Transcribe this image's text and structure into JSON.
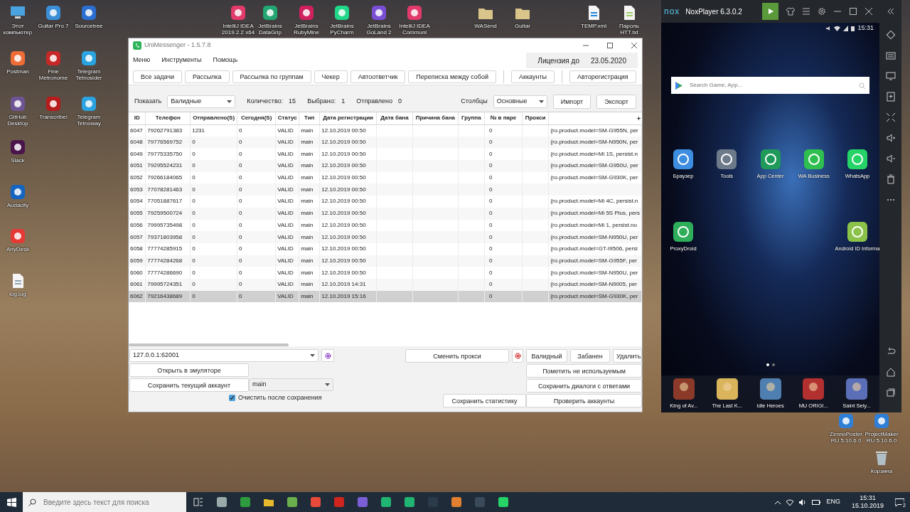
{
  "desktop": {
    "icons": [
      {
        "label": "Этот компьютер"
      },
      {
        "label": "Guitar Pro 7"
      },
      {
        "label": "Sourcetree"
      },
      {
        "label": "IntelliJ IDEA 2019.2.2 x64"
      },
      {
        "label": "JetBrains DataGrip"
      },
      {
        "label": "JetBrains RubyMine"
      },
      {
        "label": "JetBrains PyCharm"
      },
      {
        "label": "JetBrains GoLand 2"
      },
      {
        "label": "IntelliJ IDEA Communi"
      },
      {
        "label": "WASend"
      },
      {
        "label": "Guitar"
      },
      {
        "label": "TEMP.xml"
      },
      {
        "label": "Пароль HTT.txt"
      },
      {
        "label": "Postman"
      },
      {
        "label": "Fine Metronome"
      },
      {
        "label": "Telegram Tetnosider"
      },
      {
        "label": "GitHub Desktop"
      },
      {
        "label": "Transcribe!"
      },
      {
        "label": "Telegram Tetnoway"
      },
      {
        "label": "Slack"
      },
      {
        "label": "Audacity"
      },
      {
        "label": "AnyDesk"
      },
      {
        "label": "log.log"
      },
      {
        "label": "ZennoPoster RU 5.10.6.0"
      },
      {
        "label": "ProjectMaker RU 5.10.6.0"
      },
      {
        "label": "Корзина"
      }
    ]
  },
  "unimessenger": {
    "title": "UniMessenger - 1.5.7.8",
    "menu": [
      "Меню",
      "Инструменты",
      "Помощь"
    ],
    "license_label": "Лицензия до",
    "license_date": "23.05.2020",
    "toolbar_groups": [
      [
        "Все задачи",
        "Рассылка",
        "Рассылка по группам",
        "Чекер",
        "Автоответчик",
        "Переписка между собой"
      ],
      [
        "Аккаунты"
      ],
      [
        "Авторегистрация"
      ]
    ],
    "filter": {
      "show_label": "Показать",
      "show_value": "Валидные",
      "stats": [
        {
          "label": "Количество:",
          "value": "15"
        },
        {
          "label": "Выбрано:",
          "value": "1"
        },
        {
          "label": "Отправлено",
          "value": "0"
        }
      ],
      "columns_label": "Столбцы",
      "columns_value": "Основные",
      "import": "Импорт",
      "export": "Экспорт"
    },
    "table": {
      "columns": [
        "ID",
        "Телефон",
        "Отправлено(S)",
        "Сегодня(S)",
        "Статус",
        "Тип",
        "Дата регистрации",
        "Дата бана",
        "Причина бана",
        "Группа",
        "№ в паре",
        "Прокси"
      ],
      "rows": [
        {
          "id": "6047",
          "phone": "79262791383",
          "sent": "1231",
          "today": "0",
          "status": "VALID",
          "type": "main",
          "registered": "12.10.2019 00:50",
          "pair": "0",
          "column_13": "{ro.product.model=SM-G955N, per",
          "selected": false
        },
        {
          "id": "6048",
          "phone": "79776569752",
          "sent": "0",
          "today": "0",
          "status": "VALID",
          "type": "main",
          "registered": "12.10.2019 00:50",
          "pair": "0",
          "column_13": "{ro.product.model=SM-N950N, per",
          "selected": false
        },
        {
          "id": "6049",
          "phone": "79775335750",
          "sent": "0",
          "today": "0",
          "status": "VALID",
          "type": "main",
          "registered": "12.10.2019 00:50",
          "pair": "0",
          "column_13": "{ro.product.model=Mi 1S, persist.n",
          "selected": false
        },
        {
          "id": "6051",
          "phone": "79295524231",
          "sent": "0",
          "today": "0",
          "status": "VALID",
          "type": "main",
          "registered": "12.10.2019 00:50",
          "pair": "0",
          "column_13": "{ro.product.model=SM-G950U, per",
          "selected": false
        },
        {
          "id": "6052",
          "phone": "79266184065",
          "sent": "0",
          "today": "0",
          "status": "VALID",
          "type": "main",
          "registered": "12.10.2019 00:50",
          "pair": "0",
          "column_13": "{ro.product.model=SM-G930K, per",
          "selected": false
        },
        {
          "id": "6053",
          "phone": "77078281463",
          "sent": "0",
          "today": "0",
          "status": "VALID",
          "type": "main",
          "registered": "12.10.2019 00:50",
          "pair": "0",
          "selected": false
        },
        {
          "id": "6054",
          "phone": "77051887617",
          "sent": "0",
          "today": "0",
          "status": "VALID",
          "type": "main",
          "registered": "12.10.2019 00:50",
          "pair": "0",
          "column_13": "{ro.product.model=Mi 4C, persist.n",
          "selected": false
        },
        {
          "id": "6055",
          "phone": "79259500724",
          "sent": "0",
          "today": "0",
          "status": "VALID",
          "type": "main",
          "registered": "12.10.2019 00:50",
          "pair": "0",
          "column_13": "{ro.product.model=Mi 5S Plus, pers",
          "selected": false
        },
        {
          "id": "6056",
          "phone": "79995735498",
          "sent": "0",
          "today": "0",
          "status": "VALID",
          "type": "main",
          "registered": "12.10.2019 00:50",
          "pair": "0",
          "column_13": "{ro.product.model=Mi 1, persist.no",
          "selected": false
        },
        {
          "id": "6057",
          "phone": "79371803958",
          "sent": "0",
          "today": "0",
          "status": "VALID",
          "type": "main",
          "registered": "12.10.2019 00:50",
          "pair": "0",
          "column_13": "{ro.product.model=SM-N950U, per",
          "selected": false
        },
        {
          "id": "6058",
          "phone": "77774285915",
          "sent": "0",
          "today": "0",
          "status": "VALID",
          "type": "main",
          "registered": "12.10.2019 00:50",
          "pair": "0",
          "column_13": "{ro.product.model=GT-I9506, persi",
          "selected": false
        },
        {
          "id": "6059",
          "phone": "77774284268",
          "sent": "0",
          "today": "0",
          "status": "VALID",
          "type": "main",
          "registered": "12.10.2019 00:50",
          "pair": "0",
          "column_13": "{ro.product.model=SM-G955F, per",
          "selected": false
        },
        {
          "id": "6060",
          "phone": "77774286690",
          "sent": "0",
          "today": "0",
          "status": "VALID",
          "type": "main",
          "registered": "12.10.2019 00:50",
          "pair": "0",
          "column_13": "{ro.product.model=SM-N950U, per",
          "selected": false
        },
        {
          "id": "6061",
          "phone": "79995724351",
          "sent": "0",
          "today": "0",
          "status": "VALID",
          "type": "main",
          "registered": "12.10.2019 14:31",
          "pair": "0",
          "column_13": "{ro.product.model=SM-N9005, per",
          "selected": false
        },
        {
          "id": "6062",
          "phone": "79216438689",
          "sent": "0",
          "today": "0",
          "status": "VALID",
          "type": "main",
          "registered": "12.10.2019 15:16",
          "pair": "0",
          "column_13": "{ro.product.model=SM-G930K, per",
          "selected": true
        }
      ]
    },
    "bottom_panel": {
      "proxy": "127.0.0.1:62001",
      "change_proxy": "Сменить прокси",
      "mark_buttons": [
        "Валидный",
        "Забанен",
        "Удалить"
      ],
      "open_in_emulator": "Открыть в эмуляторе",
      "mark_unused": "Пометить не используемым",
      "save_account": "Сохранить текущий аккаунт",
      "account_type": "main",
      "save_dialogs": "Сохранить диалоги с ответами",
      "clear_after_save": {
        "label": "Очистить после сохранения",
        "checked": true
      },
      "save_stats": "Сохранить статистику",
      "check_accounts": "Проверить аккаунты"
    }
  },
  "nox": {
    "logo": "nox",
    "title": "NoxPlayer 6.3.0.2",
    "time": "15:31",
    "search": {
      "placeholder": "Search Game, App..."
    },
    "home_rows": [
      [
        {
          "label": "Браузер"
        },
        {
          "label": "Tools"
        },
        {
          "label": "App Center"
        },
        {
          "label": "WA Business"
        },
        {
          "label": "WhatsApp"
        }
      ],
      [
        {
          "label": "ProxyDroid"
        },
        {
          "label": "Android ID Informa"
        }
      ]
    ],
    "pages": [
      {
        "selected": true
      },
      {
        "selected": false
      }
    ],
    "dock": [
      {
        "label": "King of Av..."
      },
      {
        "label": "The Last K..."
      },
      {
        "label": "Idle Heroes"
      },
      {
        "label": "MU ORIGI..."
      },
      {
        "label": "Saint Seiy..."
      }
    ]
  },
  "taskbar": {
    "search_placeholder": "Введите здесь текст для поиска",
    "language": "ENG",
    "time": "15:31",
    "date": "15.10.2019",
    "notifications": "2"
  }
}
